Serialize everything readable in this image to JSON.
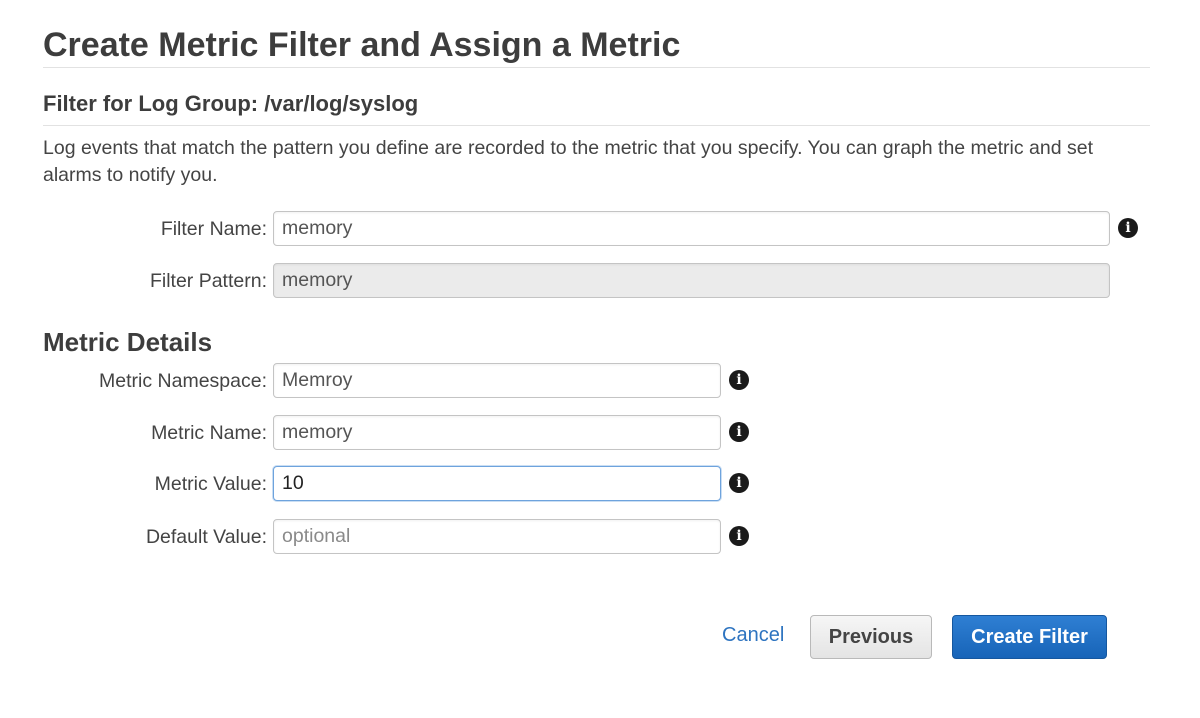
{
  "page": {
    "title": "Create Metric Filter and Assign a Metric",
    "subtitle": "Filter for Log Group: /var/log/syslog",
    "description": "Log events that match the pattern you define are recorded to the metric that you specify. You can graph the metric and set alarms to notify you."
  },
  "filter": {
    "name_label": "Filter Name:",
    "name_value": "memory",
    "pattern_label": "Filter Pattern:",
    "pattern_value": "memory"
  },
  "metric": {
    "heading": "Metric Details",
    "namespace_label": "Metric Namespace:",
    "namespace_value": "Memroy",
    "name_label": "Metric Name:",
    "name_value": "memory",
    "value_label": "Metric Value:",
    "value_value": "10",
    "default_label": "Default Value:",
    "default_placeholder": "optional"
  },
  "icons": {
    "info": "i"
  },
  "actions": {
    "cancel_label": "Cancel",
    "previous_label": "Previous",
    "create_label": "Create Filter"
  },
  "colors": {
    "link": "#2e74c0",
    "primary_button": "#1f6fc5",
    "focus_border": "#6ea3dd"
  }
}
